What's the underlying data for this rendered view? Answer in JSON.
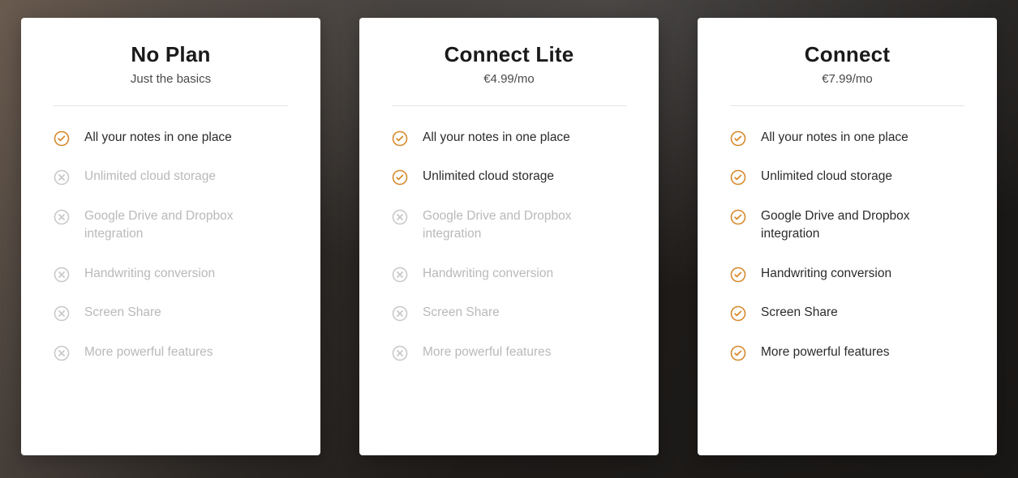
{
  "accent_color": "#d68a2d",
  "plans": [
    {
      "id": "no-plan",
      "title": "No Plan",
      "subtitle": "Just the basics",
      "features": [
        {
          "label": "All your notes in one place",
          "included": true
        },
        {
          "label": "Unlimited cloud storage",
          "included": false
        },
        {
          "label": "Google Drive and Dropbox integration",
          "included": false
        },
        {
          "label": "Handwriting conversion",
          "included": false
        },
        {
          "label": "Screen Share",
          "included": false
        },
        {
          "label": "More powerful features",
          "included": false
        }
      ]
    },
    {
      "id": "connect-lite",
      "title": "Connect Lite",
      "subtitle": "€4.99/mo",
      "features": [
        {
          "label": "All your notes in one place",
          "included": true
        },
        {
          "label": "Unlimited cloud storage",
          "included": true
        },
        {
          "label": "Google Drive and Dropbox integration",
          "included": false
        },
        {
          "label": "Handwriting conversion",
          "included": false
        },
        {
          "label": "Screen Share",
          "included": false
        },
        {
          "label": "More powerful features",
          "included": false
        }
      ]
    },
    {
      "id": "connect",
      "title": "Connect",
      "subtitle": "€7.99/mo",
      "features": [
        {
          "label": "All your notes in one place",
          "included": true
        },
        {
          "label": "Unlimited cloud storage",
          "included": true
        },
        {
          "label": "Google Drive and Dropbox integration",
          "included": true
        },
        {
          "label": "Handwriting conversion",
          "included": true
        },
        {
          "label": "Screen Share",
          "included": true
        },
        {
          "label": "More powerful features",
          "included": true
        }
      ]
    }
  ]
}
